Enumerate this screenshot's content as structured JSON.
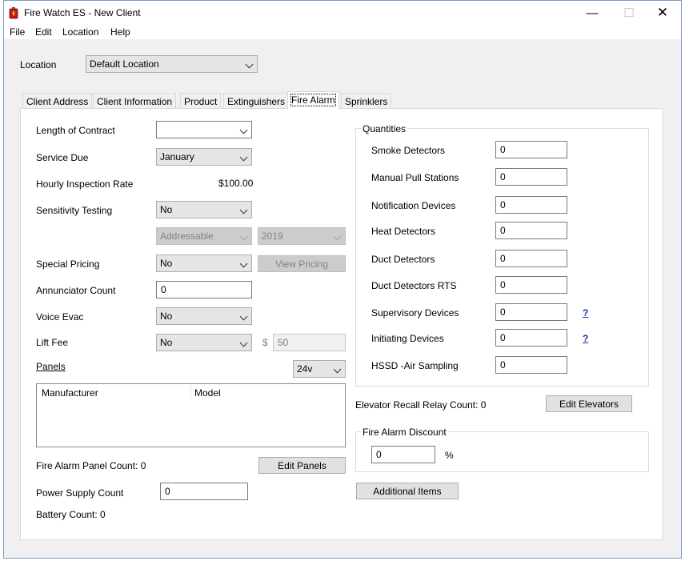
{
  "window": {
    "title": "Fire Watch ES - New Client",
    "controls": {
      "minimize": "—",
      "maximize": "☐",
      "close": "✕"
    }
  },
  "menu": [
    "File",
    "Edit",
    "Location",
    "Help"
  ],
  "location": {
    "label": "Location",
    "value": "Default Location"
  },
  "tabs": [
    "Client Address",
    "Client Information",
    "Product",
    "Extinguishers",
    "Fire Alarm",
    "Sprinklers"
  ],
  "active_tab": "Fire Alarm",
  "left": {
    "length_of_contract": {
      "label": "Length of Contract",
      "value": ""
    },
    "service_due": {
      "label": "Service Due",
      "value": "January"
    },
    "hourly_rate": {
      "label": "Hourly Inspection Rate",
      "value": "$100.00"
    },
    "sensitivity_testing": {
      "label": "Sensitivity Testing",
      "value": "No",
      "type_value": "Addressable",
      "year_value": "2019"
    },
    "special_pricing": {
      "label": "Special Pricing",
      "value": "No",
      "button": "View Pricing"
    },
    "annunciator_count": {
      "label": "Annunciator Count",
      "value": "0"
    },
    "voice_evac": {
      "label": "Voice Evac",
      "value": "No"
    },
    "lift_fee": {
      "label": "Lift Fee",
      "value": "No",
      "currency": "$",
      "amount": "50"
    },
    "panels": {
      "label": "Panels",
      "voltage": "24v",
      "columns": [
        "Manufacturer",
        "Model"
      ]
    },
    "panel_count": "Fire Alarm Panel Count: 0",
    "edit_panels": "Edit Panels",
    "power_supply": {
      "label": "Power Supply Count",
      "value": "0"
    },
    "battery_count": "Battery Count: 0"
  },
  "quantities": {
    "title": "Quantities",
    "smoke": {
      "label": "Smoke Detectors",
      "value": "0"
    },
    "pull": {
      "label": "Manual Pull Stations",
      "value": "0"
    },
    "notification": {
      "label": "Notification Devices",
      "value": "0"
    },
    "heat": {
      "label": "Heat Detectors",
      "value": "0"
    },
    "duct": {
      "label": "Duct Detectors",
      "value": "0"
    },
    "duct_rts": {
      "label": "Duct Detectors RTS",
      "value": "0"
    },
    "supervisory": {
      "label": "Supervisory Devices",
      "value": "0",
      "help": "?"
    },
    "initiating": {
      "label": "Initiating Devices",
      "value": "0",
      "help": "?"
    },
    "hssd": {
      "label": "HSSD -Air Sampling",
      "value": "0"
    }
  },
  "elevator": {
    "label": "Elevator Recall Relay Count: 0",
    "button": "Edit Elevators"
  },
  "discount": {
    "title": "Fire Alarm Discount",
    "value": "0",
    "unit": "%"
  },
  "additional_items": "Additional Items"
}
